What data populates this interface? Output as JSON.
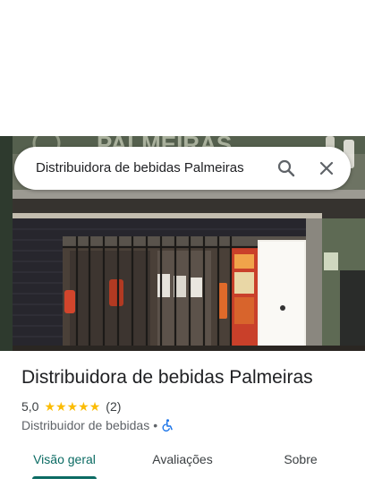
{
  "search": {
    "query": "Distribuidora de bebidas Palmeiras",
    "search_icon": "search-icon",
    "close_icon": "close-icon"
  },
  "place": {
    "photo_sign_text": "PALMEIRAS",
    "title": "Distribuidora de bebidas Palmeiras",
    "rating": "5,0",
    "stars": 5,
    "review_count": "(2)",
    "category": "Distribuidor de bebidas",
    "separator": "•",
    "accessibility_icon": "wheelchair-icon"
  },
  "tabs": [
    {
      "label": "Visão geral",
      "active": true
    },
    {
      "label": "Avaliações",
      "active": false
    },
    {
      "label": "Sobre",
      "active": false
    }
  ],
  "colors": {
    "accent": "#0b6b63",
    "star": "#fbbc04",
    "accessibility": "#1a73e8"
  }
}
